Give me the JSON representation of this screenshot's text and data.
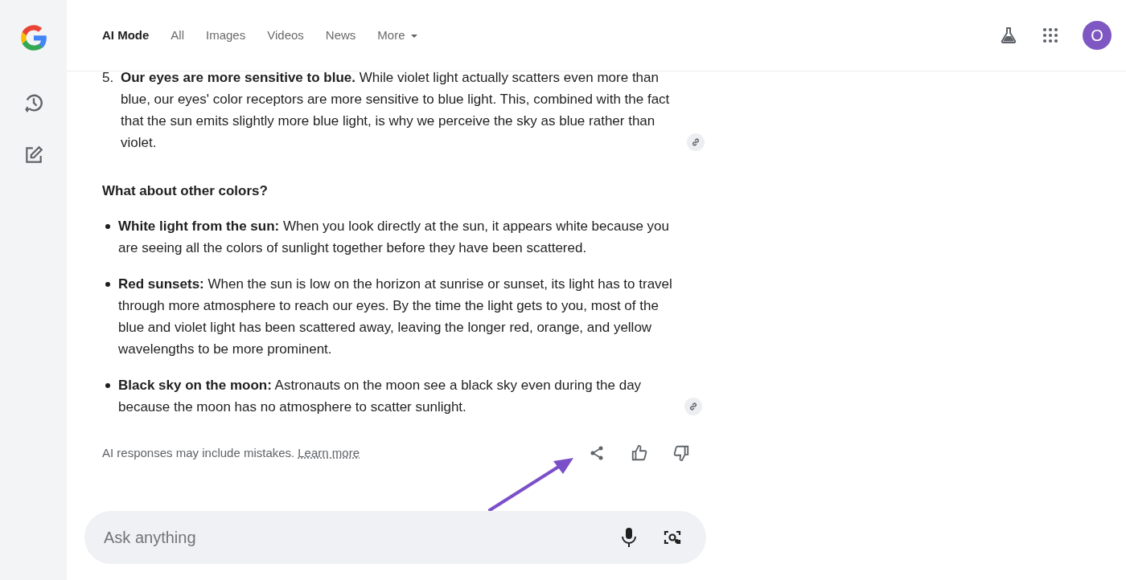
{
  "tabs": [
    {
      "label": "AI Mode",
      "selected": true,
      "dropdown": false
    },
    {
      "label": "All",
      "selected": false,
      "dropdown": false
    },
    {
      "label": "Images",
      "selected": false,
      "dropdown": false
    },
    {
      "label": "Videos",
      "selected": false,
      "dropdown": false
    },
    {
      "label": "News",
      "selected": false,
      "dropdown": false
    },
    {
      "label": "More",
      "selected": false,
      "dropdown": true
    }
  ],
  "profile": {
    "initial": "O"
  },
  "answer": {
    "numbered": [
      {
        "number": "5.",
        "text": "**Our eyes are more sensitive to blue.** While violet light actually scatters even more than blue, our eyes' color receptors are more sensitive to blue light. This, combined with the fact that the sun emits slightly more blue light, is why we perceive the sky as blue rather than violet.",
        "source_link": true
      }
    ],
    "heading": "What about other colors?",
    "bullets": [
      {
        "text": "**White light from the sun:** When you look directly at the sun, it appears white because you are seeing all the colors of sunlight together before they have been scattered.",
        "source_link": false
      },
      {
        "text": "**Red sunsets:** When the sun is low on the horizon at sunrise or sunset, its light has to travel through more atmosphere to reach our eyes. By the time the light gets to you, most of the blue and violet light has been scattered away, leaving the longer red, orange, and yellow wavelengths to be more prominent.",
        "source_link": false
      },
      {
        "text": "**Black sky on the moon:** Astronauts on the moon see a black sky even during the day because the moon has no atmosphere to scatter sunlight.",
        "source_link": true
      }
    ]
  },
  "disclaimer": {
    "text": "AI responses may include mistakes.",
    "link": "Learn more"
  },
  "search": {
    "placeholder": "Ask anything"
  }
}
